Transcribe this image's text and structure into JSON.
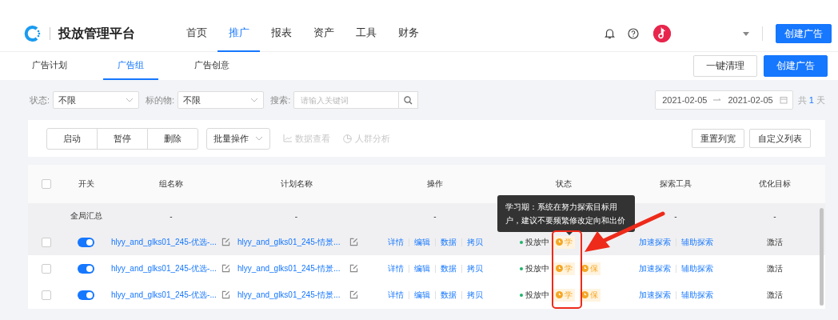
{
  "header": {
    "app_title": "投放管理平台",
    "nav": [
      {
        "label": "首页",
        "selected": false
      },
      {
        "label": "推广",
        "selected": true
      },
      {
        "label": "报表",
        "selected": false
      },
      {
        "label": "资产",
        "selected": false
      },
      {
        "label": "工具",
        "selected": false
      },
      {
        "label": "财务",
        "selected": false
      }
    ],
    "create_button": "创建广告"
  },
  "tabs": [
    {
      "label": "广告计划",
      "selected": false
    },
    {
      "label": "广告组",
      "selected": true
    },
    {
      "label": "广告创意",
      "selected": false
    }
  ],
  "tab_actions": [
    {
      "label": "一键清理",
      "kind": "default"
    },
    {
      "label": "创建广告",
      "kind": "primary"
    }
  ],
  "filters": [
    {
      "kind": "select",
      "label": "状态:",
      "value": "不限"
    },
    {
      "kind": "select",
      "label": "标的物:",
      "value": "不限"
    },
    {
      "kind": "search",
      "label": "搜索:",
      "placeholder": "请输入关键词"
    }
  ],
  "date_range": {
    "start": "2021-02-05",
    "end": "2021-02-05",
    "total_prefix": "共",
    "total_count": "1",
    "total_suffix": "天"
  },
  "toolbar": {
    "button_group": [
      "启动",
      "暂停",
      "删除"
    ],
    "batch": "批量操作",
    "links": [
      {
        "label": "数据查看",
        "disabled": true
      },
      {
        "label": "人群分析",
        "disabled": true
      }
    ],
    "right_buttons": [
      "重置列宽",
      "自定义列表"
    ]
  },
  "table": {
    "header_checked": false,
    "columns": [
      "开关",
      "组名称",
      "计划名称",
      "操作",
      "状态",
      "探索工具",
      "优化目标"
    ],
    "summary": {
      "label": "全局汇总",
      "group": "-",
      "plan": "-",
      "actions": "-",
      "explore": "-",
      "goal": "-"
    },
    "rows": [
      {
        "highlighted": true,
        "checked": false,
        "on": true,
        "group_name": "hlyy_and_glks01_245-优选-...",
        "plan_name": "hlyy_and_glks01_245-情景...",
        "actions": [
          "详情",
          "编辑",
          "数据",
          "拷贝"
        ],
        "status": "投放中",
        "badges": [
          "学"
        ],
        "explore": [
          "加速探索",
          "辅助探索"
        ],
        "goal": "激活"
      },
      {
        "highlighted": false,
        "checked": false,
        "on": true,
        "group_name": "hlyy_and_glks01_245-优选-...",
        "plan_name": "hlyy_and_glks01_245-情景...",
        "actions": [
          "详情",
          "编辑",
          "数据",
          "拷贝"
        ],
        "status": "投放中",
        "badges": [
          "学",
          "保"
        ],
        "explore": [
          "加速探索",
          "辅助探索"
        ],
        "goal": "激活"
      },
      {
        "highlighted": false,
        "checked": false,
        "on": true,
        "group_name": "hlyy_and_glks01_245-优选-...",
        "plan_name": "hlyy_and_glks01_245-情景...",
        "actions": [
          "详情",
          "编辑",
          "数据",
          "拷贝"
        ],
        "status": "投放中",
        "badges": [
          "学",
          "保"
        ],
        "explore": [
          "加速探索",
          "辅助探索"
        ],
        "goal": "激活"
      }
    ]
  },
  "tooltip": {
    "text": "学习期：系统在努力探索目标用户，建议不要频繁修改定向和出价"
  }
}
